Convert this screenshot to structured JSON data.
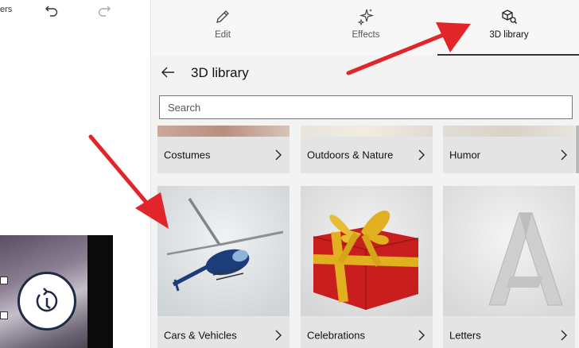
{
  "left": {
    "toolbar_text": "ers"
  },
  "tabs": [
    {
      "label": "Edit",
      "icon": "pencil-icon"
    },
    {
      "label": "Effects",
      "icon": "sparkle-icon"
    },
    {
      "label": "3D library",
      "icon": "cube-search-icon",
      "active": true
    }
  ],
  "library": {
    "title": "3D library",
    "search_placeholder": "Search",
    "search_value": "",
    "categories": [
      {
        "label": "Costumes"
      },
      {
        "label": "Outdoors & Nature"
      },
      {
        "label": "Humor"
      },
      {
        "label": "Cars & Vehicles",
        "thumb": "helicopter"
      },
      {
        "label": "Celebrations",
        "thumb": "gift-box"
      },
      {
        "label": "Letters",
        "thumb": "letter-a"
      }
    ]
  },
  "colors": {
    "accent": "#333333",
    "annotation_arrow": "#e0262b",
    "gift_red": "#c81e1e",
    "gift_ribbon": "#e0b020",
    "helicopter_blue": "#1c3d7a"
  }
}
